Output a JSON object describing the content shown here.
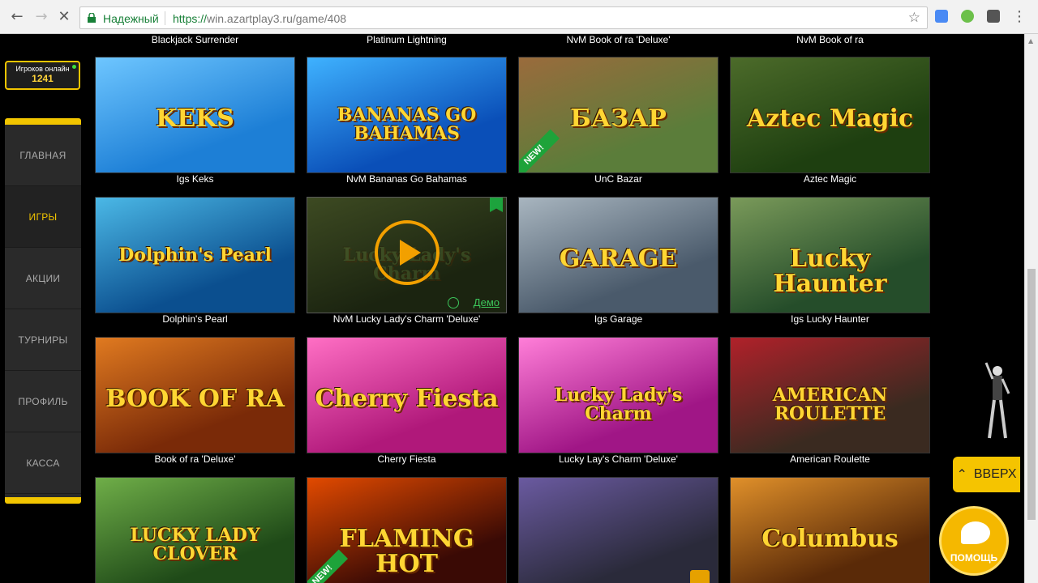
{
  "browser": {
    "security_label": "Надежный",
    "url_scheme": "https://",
    "url_rest": "win.azartplay3.ru/game/408"
  },
  "online": {
    "label": "Игроков онлайн",
    "count": "1241"
  },
  "sidebar": {
    "items": [
      {
        "label": "ГЛАВНАЯ",
        "active": false
      },
      {
        "label": "ИГРЫ",
        "active": true
      },
      {
        "label": "АКЦИИ",
        "active": false
      },
      {
        "label": "ТУРНИРЫ",
        "active": false
      },
      {
        "label": "ПРОФИЛЬ",
        "active": false
      },
      {
        "label": "КАССА",
        "active": false
      }
    ]
  },
  "top_captions": [
    "Blackjack Surrender",
    "Platinum Lightning",
    "NvM Book of ra 'Deluxe'",
    "NvM Book of ra"
  ],
  "games": [
    {
      "caption": "Igs Keks",
      "art_text": "KEKS",
      "bg": "#1d7fd6",
      "bg2": "#6ec6ff",
      "new": false
    },
    {
      "caption": "NvM Bananas Go Bahamas",
      "art_text": "BANANAS GO BAHAMAS",
      "bg": "#0a4fb8",
      "bg2": "#3fb2ff",
      "new": false
    },
    {
      "caption": "UnC Bazar",
      "art_text": "БАЗАР",
      "bg": "#5b7d3a",
      "bg2": "#9a6b3c",
      "new": true,
      "new_label": "NEW!"
    },
    {
      "caption": "Aztec Magic",
      "art_text": "Aztec Magic",
      "bg": "#1e3f10",
      "bg2": "#4c6b2a",
      "new": false
    },
    {
      "caption": "Dolphin's Pearl",
      "art_text": "Dolphin's Pearl",
      "bg": "#0b4f8f",
      "bg2": "#4bb8e6",
      "new": false
    },
    {
      "caption": "NvM Lucky Lady's Charm 'Deluxe'",
      "art_text": "Lucky Lady's Charm",
      "bg": "#1b2410",
      "bg2": "#3d4a22",
      "new": false,
      "hover": true,
      "demo_label": "Демо"
    },
    {
      "caption": "Igs Garage",
      "art_text": "GARAGE",
      "bg": "#4a5a6b",
      "bg2": "#a8b5bf",
      "new": false
    },
    {
      "caption": "Igs Lucky Haunter",
      "art_text": "Lucky Haunter",
      "bg": "#254d2a",
      "bg2": "#7a9a5a",
      "new": false
    },
    {
      "caption": "Book of ra 'Deluxe'",
      "art_text": "BOOK OF RA",
      "bg": "#7a2a08",
      "bg2": "#e07a20",
      "new": false
    },
    {
      "caption": "Cherry Fiesta",
      "art_text": "Cherry Fiesta",
      "bg": "#b0187a",
      "bg2": "#ff6fc4",
      "new": false
    },
    {
      "caption": "Lucky Lay's Charm 'Deluxe'",
      "art_text": "Lucky Lady's Charm",
      "bg": "#a01686",
      "bg2": "#ff7ed8",
      "new": false
    },
    {
      "caption": "American Roulette",
      "art_text": "AMERICAN ROULETTE",
      "bg": "#3a2a20",
      "bg2": "#b0212a",
      "new": false
    },
    {
      "caption": "",
      "art_text": "LUCKY LADY CLOVER",
      "bg": "#1f4a18",
      "bg2": "#6fae48",
      "new": false
    },
    {
      "caption": "",
      "art_text": "FLAMING HOT",
      "bg": "#3a0a05",
      "bg2": "#e24a00",
      "new": true,
      "new_label": "NEW!"
    },
    {
      "caption": "",
      "art_text": "",
      "bg": "#2a2a3a",
      "bg2": "#6a5aa0",
      "new": false,
      "locked": true
    },
    {
      "caption": "",
      "art_text": "Columbus",
      "bg": "#5a2a08",
      "bg2": "#e0902a",
      "new": false
    }
  ],
  "up_button": {
    "label": "ВВЕРХ"
  },
  "help_button": {
    "label": "ПОМОЩЬ"
  }
}
